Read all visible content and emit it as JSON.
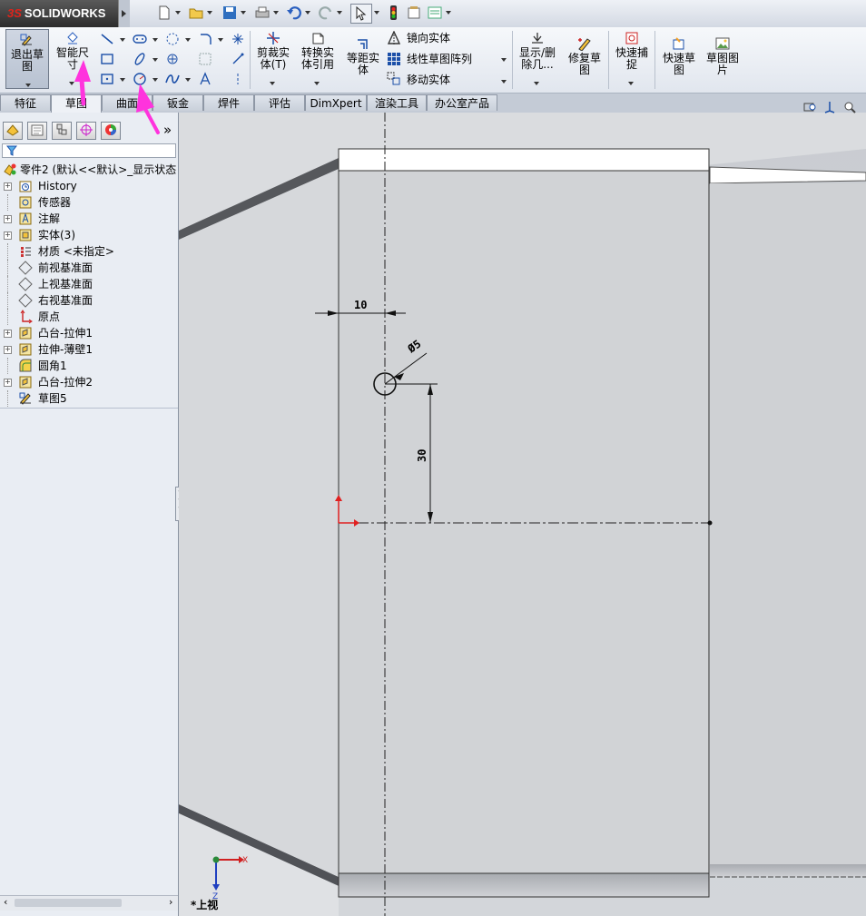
{
  "app": {
    "logo_prefix": "3S",
    "logo_text": "SOLIDWORKS"
  },
  "quick_access": {
    "icons": [
      "new-document-icon",
      "open-folder-icon",
      "save-icon",
      "print-icon",
      "undo-icon",
      "redo-icon",
      "select-arrow-icon",
      "rebuild-traffic-light-icon",
      "options-icon",
      "customize-icon"
    ]
  },
  "ribbon": {
    "exit_sketch": "退出草图",
    "smart_dimension": "智能尺寸",
    "trim_entities": "剪裁实体(T)",
    "convert_entities": "转换实体引用",
    "offset_entities": "等距实体",
    "mirror_entities": "镜向实体",
    "linear_pattern": "线性草图阵列",
    "move_entities": "移动实体",
    "display_delete": "显示/删除几...",
    "repair_sketch": "修复草图",
    "quick_snaps": "快速捕捉",
    "rapid_sketch": "快速草图",
    "sketch_picture": "草图图片"
  },
  "tabs": [
    "特征",
    "草图",
    "曲面",
    "钣金",
    "焊件",
    "评估",
    "DimXpert",
    "渲染工具",
    "办公室产品"
  ],
  "active_tab": "草图",
  "tree": {
    "root": "零件2 (默认<<默认>_显示状态",
    "items": [
      {
        "label": "History",
        "icon": "history-icon",
        "expandable": true
      },
      {
        "label": "传感器",
        "icon": "sensor-icon",
        "expandable": false
      },
      {
        "label": "注解",
        "icon": "annotation-icon",
        "expandable": true
      },
      {
        "label": "实体(3)",
        "icon": "solid-bodies-icon",
        "expandable": true
      },
      {
        "label": "材质 <未指定>",
        "icon": "material-icon",
        "expandable": false
      },
      {
        "label": "前视基准面",
        "icon": "plane-icon",
        "expandable": false
      },
      {
        "label": "上视基准面",
        "icon": "plane-icon",
        "expandable": false
      },
      {
        "label": "右视基准面",
        "icon": "plane-icon",
        "expandable": false
      },
      {
        "label": "原点",
        "icon": "origin-icon",
        "expandable": false
      },
      {
        "label": "凸台-拉伸1",
        "icon": "extrude-icon",
        "expandable": true
      },
      {
        "label": "拉伸-薄壁1",
        "icon": "extrude-icon",
        "expandable": true
      },
      {
        "label": "圆角1",
        "icon": "fillet-icon",
        "expandable": false
      },
      {
        "label": "凸台-拉伸2",
        "icon": "extrude-icon",
        "expandable": true
      },
      {
        "label": "草图5",
        "icon": "sketch-icon",
        "expandable": false
      }
    ]
  },
  "panel_more": "»",
  "drawing": {
    "dim_horizontal": "10",
    "dim_diameter": "Ø5",
    "dim_vertical": "30",
    "view_label": "*上视",
    "axis_x": "X",
    "axis_z": "Z"
  },
  "colors": {
    "annotation_arrow": "#ff33dd",
    "origin_red": "#e02020"
  }
}
